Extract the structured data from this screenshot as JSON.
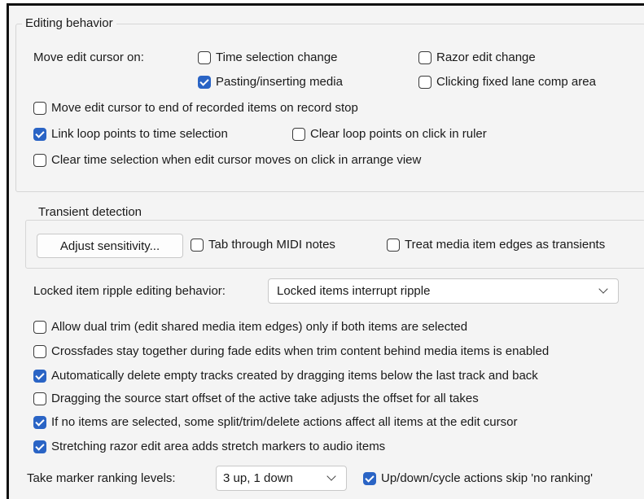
{
  "editing_behavior": {
    "group_title": "Editing behavior",
    "move_edit_cursor_label": "Move edit cursor on:",
    "options": {
      "time_selection_change": {
        "label": "Time selection change",
        "checked": false
      },
      "razor_edit_change": {
        "label": "Razor edit change",
        "checked": false
      },
      "pasting_inserting_media": {
        "label": "Pasting/inserting media",
        "checked": true
      },
      "clicking_fixed_lane": {
        "label": "Clicking fixed lane comp area",
        "checked": false
      },
      "move_to_end_recorded": {
        "label": "Move edit cursor to end of recorded items on record stop",
        "checked": false
      },
      "link_loop_points": {
        "label": "Link loop points to time selection",
        "checked": true
      },
      "clear_loop_points": {
        "label": "Clear loop points on click in ruler",
        "checked": false
      },
      "clear_time_selection": {
        "label": "Clear time selection when edit cursor moves on click in arrange view",
        "checked": false
      }
    }
  },
  "transient_detection": {
    "group_title": "Transient detection",
    "adjust_button": "Adjust sensitivity...",
    "tab_midi": {
      "label": "Tab through MIDI notes",
      "checked": false
    },
    "treat_edges": {
      "label": "Treat media item edges as transients",
      "checked": false
    }
  },
  "locked_ripple": {
    "label": "Locked item ripple editing behavior:",
    "selected": "Locked items interrupt ripple"
  },
  "lower_options": {
    "allow_dual_trim": {
      "label": "Allow dual trim (edit shared media item edges) only if both items are selected",
      "checked": false
    },
    "crossfades_together": {
      "label": "Crossfades stay together during fade edits when trim content behind media items is enabled",
      "checked": false
    },
    "auto_delete_tracks": {
      "label": "Automatically delete empty tracks created by dragging items below the last track and back",
      "checked": true
    },
    "drag_source_offset": {
      "label": "Dragging the source start offset of the active take adjusts the offset for all takes",
      "checked": false
    },
    "no_items_selected": {
      "label": "If no items are selected, some split/trim/delete actions affect all items at the edit cursor",
      "checked": true
    },
    "stretch_razor": {
      "label": "Stretching razor edit area adds stretch markers to audio items",
      "checked": true
    }
  },
  "take_marker": {
    "label": "Take marker ranking levels:",
    "selected": "3 up, 1 down",
    "skip_no_ranking": {
      "label": "Up/down/cycle actions skip 'no ranking'",
      "checked": true
    }
  },
  "colors": {
    "accent": "#2a64c5",
    "panel_bg": "#f4f4f4",
    "border": "#d6d6d6"
  }
}
